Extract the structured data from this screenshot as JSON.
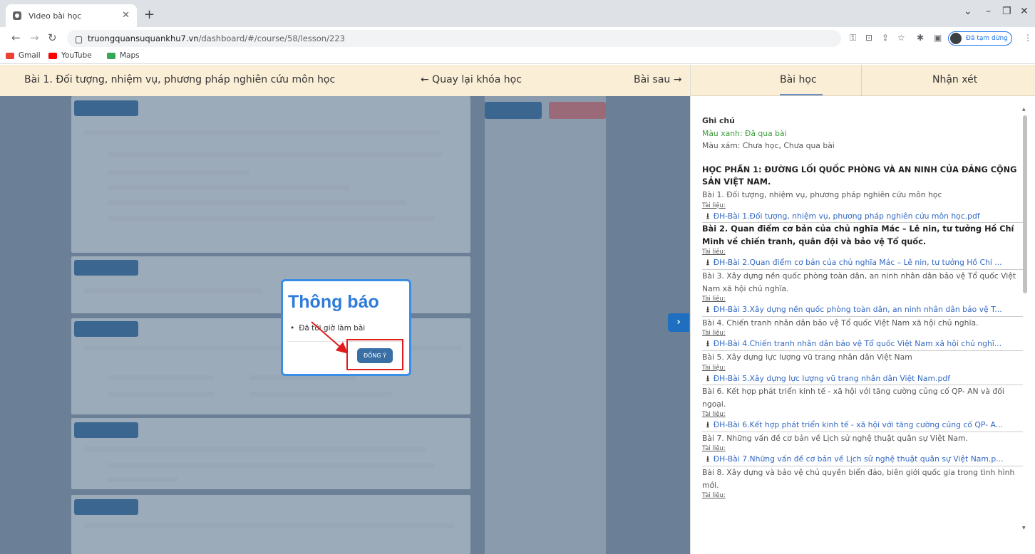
{
  "browser": {
    "tab_title": "Video bài học",
    "url_host": "truongquansuquankhu7.vn",
    "url_path": "/dashboard/#/course/58/lesson/223",
    "profile_status": "Đã tạm dừng",
    "bookmarks": [
      {
        "label": "Gmail",
        "color": "#ea4335"
      },
      {
        "label": "YouTube",
        "color": "#ff0000"
      },
      {
        "label": "Maps",
        "color": "#34a853"
      }
    ]
  },
  "topbar": {
    "lesson_title": "Bài 1. Đối tượng, nhiệm vụ, phương pháp nghiên cứu môn học",
    "back_label": "← Quay lại khóa học",
    "next_label": "Bài sau →"
  },
  "modal": {
    "title": "Thông báo",
    "message": "Đã tới giờ làm bài",
    "button_label": "ĐỒNG Ý"
  },
  "right_panel": {
    "tabs": [
      "Bài học",
      "Nhận xét"
    ],
    "note_title": "Ghi chú",
    "note_green": "Màu xanh: Đã qua bài",
    "note_gray": "Màu xám: Chưa học, Chưa qua bài",
    "section_title": "HỌC PHẦN 1: ĐƯỜNG LỐI QUỐC PHÒNG VÀ AN NINH CỦA ĐẢNG CỘNG SẢN VIỆT NAM.",
    "doc_label": "Tài liệu:",
    "lessons": [
      {
        "title": "Bài 1. Đối tượng, nhiệm vụ, phương pháp nghiên cứu môn học",
        "bold": false,
        "file": "ĐH-Bài 1.Đối tượng, nhiệm vụ, phương pháp nghiên cứu môn học.pdf"
      },
      {
        "title": "Bài 2. Quan điểm cơ bản của chủ nghĩa Mác – Lê nin, tư tưởng Hồ Chí Minh về chiến tranh, quân đội và bảo vệ Tổ quốc.",
        "bold": true,
        "file": "ĐH-Bài 2.Quan điểm cơ bản của chủ nghĩa Mác – Lê nin, tư tưởng Hồ Chí ..."
      },
      {
        "title": "Bài 3. Xây dựng nền quốc phòng toàn dân, an ninh nhân dân bảo vệ Tổ quốc Việt Nam xã hội chủ nghĩa.",
        "bold": false,
        "file": "ĐH-Bài 3.Xây dựng nền quốc phòng toàn dân, an ninh nhân dân bảo vệ T..."
      },
      {
        "title": "Bài 4. Chiến tranh nhân dân bảo vệ Tổ quốc Việt Nam xã hội chủ nghĩa.",
        "bold": false,
        "file": "ĐH-Bài 4.Chiến tranh nhân dân bảo vệ Tổ quốc Việt Nam xã hội chủ nghĩ..."
      },
      {
        "title": "Bài 5. Xây dựng lực lượng vũ trang nhân dân Việt Nam",
        "bold": false,
        "file": "ĐH-Bài 5.Xây dựng lực lượng vũ trang nhân dân Việt Nam.pdf"
      },
      {
        "title": "Bài 6. Kết hợp phát triển kinh tế - xã hội với tăng cường củng cố QP- AN và đối ngoại.",
        "bold": false,
        "file": "ĐH-Bài 6.Kết hợp phát triển kinh tế - xã hội với tăng cường củng cố QP- A..."
      },
      {
        "title": "Bài 7. Những vấn đề cơ bản về Lịch sử nghệ thuật quân sự Việt Nam.",
        "bold": false,
        "file": "ĐH-Bài 7.Những vấn đề cơ bản về Lịch sử nghệ thuật quân sự Việt Nam.p..."
      },
      {
        "title": "Bài 8. Xây dựng và bảo vệ chủ quyền biển đảo, biên giới quốc gia trong tình hình mới.",
        "bold": false,
        "file": ""
      }
    ]
  }
}
